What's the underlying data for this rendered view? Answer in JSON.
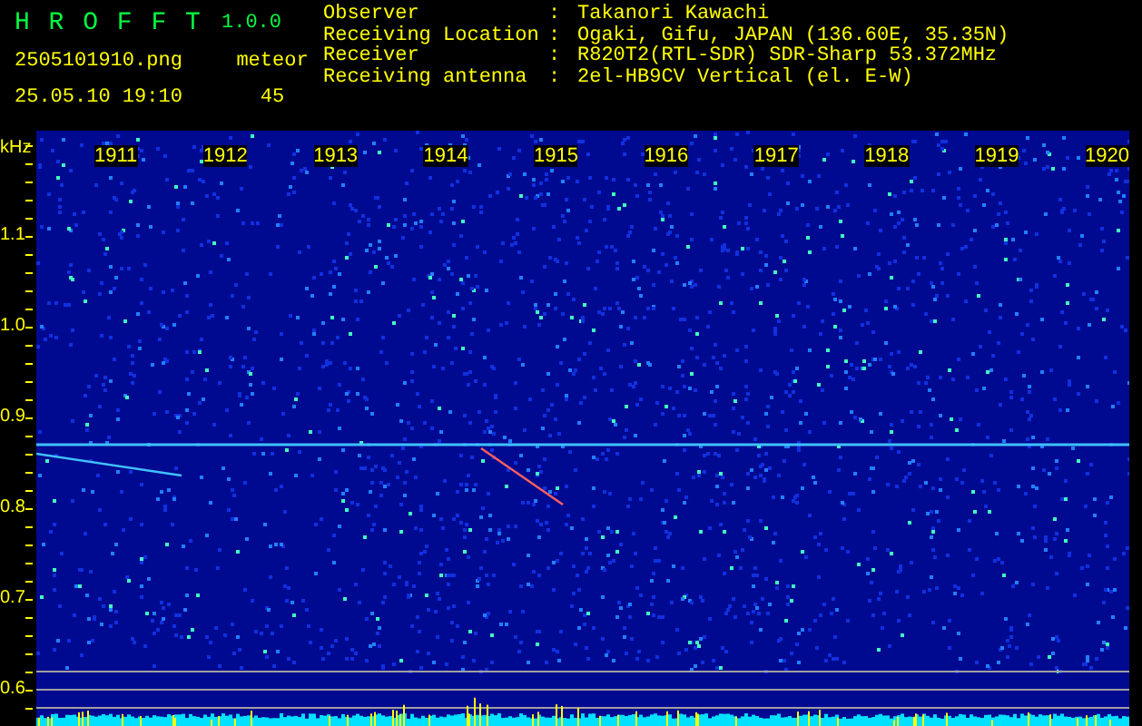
{
  "header": {
    "app_name": "H R O F F T",
    "version": "1.0.0",
    "filename": "2505101910.png",
    "datetime": "25.05.10 19:10",
    "detection_label": "meteor",
    "detection_count": "45"
  },
  "info_separator": ":",
  "info": [
    {
      "label": "Observer",
      "value": "Takanori Kawachi"
    },
    {
      "label": "Receiving Location",
      "value": "Ogaki, Gifu, JAPAN (136.60E, 35.35N)"
    },
    {
      "label": "Receiver",
      "value": "R820T2(RTL-SDR) SDR-Sharp 53.372MHz"
    },
    {
      "label": "Receiving antenna",
      "value": "2el-HB9CV Vertical (el. E-W)"
    }
  ],
  "plot": {
    "y_unit": "kHz",
    "x_labels": [
      "1911",
      "1912",
      "1913",
      "1914",
      "1915",
      "1916",
      "1917",
      "1918",
      "1919",
      "1920"
    ],
    "y_labels": [
      "1.1",
      "1.0",
      "0.9",
      "0.8",
      "0.7",
      "0.6"
    ]
  }
}
